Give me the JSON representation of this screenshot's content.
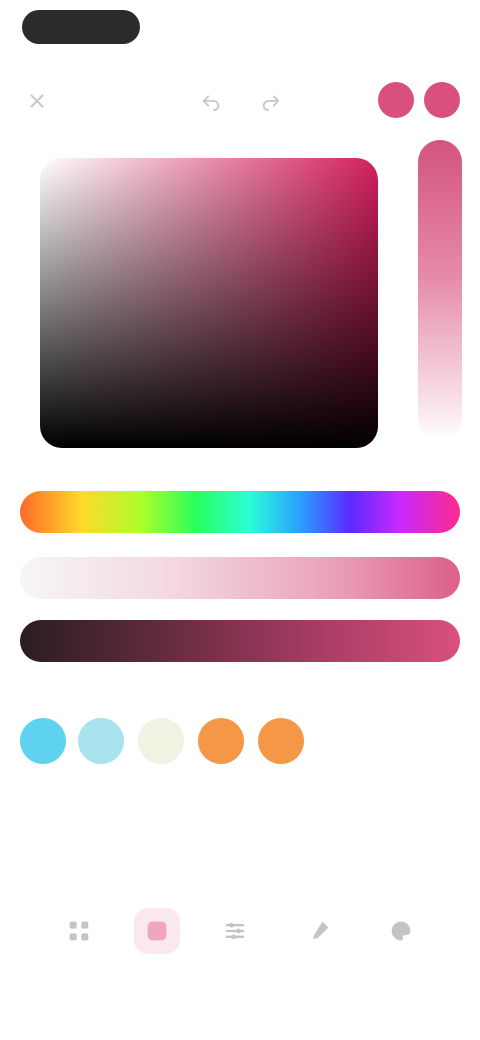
{
  "toolbar": {
    "icons": [
      "close-icon",
      "undo-icon",
      "redo-icon"
    ]
  },
  "color": {
    "accent": "#d63f6e",
    "current_swatch": "#d9507f",
    "previous_swatch": "#d9507f"
  },
  "recent_colors": [
    "#5fd2ef",
    "#a9e4ee",
    "#eef3e2",
    "#f49848",
    "#f49848"
  ],
  "tabs": [
    {
      "icon": "grid-icon",
      "selected": false
    },
    {
      "icon": "spectrum-icon",
      "selected": true
    },
    {
      "icon": "sliders-icon",
      "selected": false
    },
    {
      "icon": "eyedropper-icon",
      "selected": false
    },
    {
      "icon": "palette-icon",
      "selected": false
    }
  ]
}
